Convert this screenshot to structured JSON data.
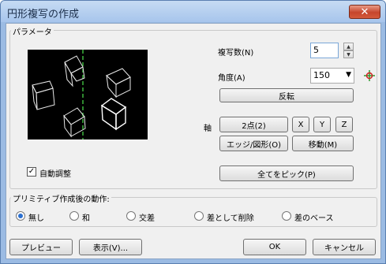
{
  "window": {
    "title": "円形複写の作成",
    "close_label": "✕"
  },
  "parameters": {
    "group_label": "パラメータ",
    "copies_label": "複写数(N)",
    "copies_value": "5",
    "angle_label": "角度(A)",
    "angle_value": "150",
    "reverse_button": "反転",
    "axis_label": "軸",
    "axis_buttons": {
      "two_points": "2点(2)",
      "x": "X",
      "y": "Y",
      "z": "Z",
      "edge_shape": "エッジ/図形(O)",
      "move": "移動(M)"
    },
    "pick_all_button": "全てをピック(P)",
    "auto_adjust_label": "自動調整",
    "auto_adjust_checked": true
  },
  "post_action": {
    "group_label": "プリミティブ作成後の動作:",
    "options": [
      "無し",
      "和",
      "交差",
      "差として削除",
      "差のベース"
    ],
    "selected": 0
  },
  "footer": {
    "preview_button": "プレビュー",
    "display_button": "表示(V)...",
    "ok_button": "OK",
    "cancel_button": "キャンセル"
  },
  "colors": {
    "axis_line": "#3cb43c",
    "selected_cube": "#ffffff",
    "cube": "#e8e8e8"
  }
}
